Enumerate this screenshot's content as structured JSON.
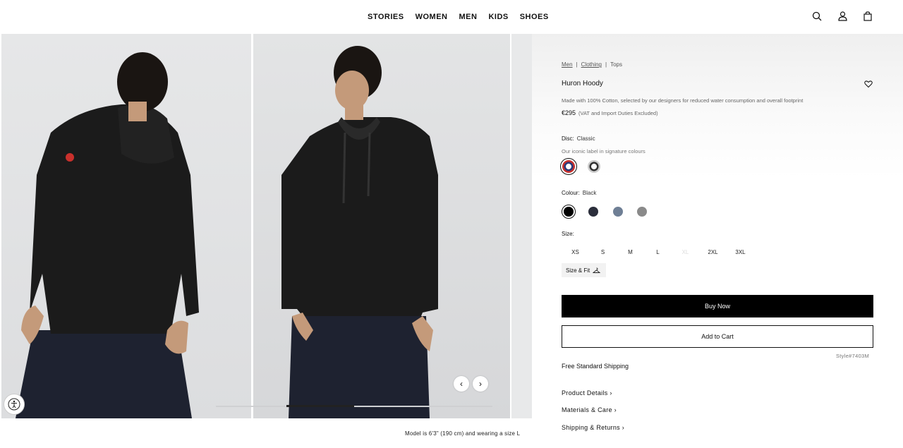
{
  "nav": {
    "links": [
      "STORIES",
      "WOMEN",
      "MEN",
      "KIDS",
      "SHOES"
    ],
    "icons": [
      "search-icon",
      "account-icon",
      "bag-icon"
    ]
  },
  "gallery": {
    "caption": "Model is 6'3\" (190 cm) and wearing a size L",
    "progress": 0.25
  },
  "product": {
    "breadcrumbs": [
      "Men",
      "Clothing",
      "Tops"
    ],
    "name": "Huron Hoody",
    "description": "Made with 100% Cotton, selected by our designers for reduced water consumption and overall footprint",
    "price": "€295",
    "tax_note": "(VAT and Import Duties Excluded)",
    "disc_label": "Disc:",
    "disc_value": "Classic",
    "disc_sub": "Our iconic label in signature colours",
    "colour_label": "Colour:",
    "colour_value": "Black",
    "colours": [
      "#000000",
      "#2b2e3b",
      "#6f7f95",
      "#8a8a8a"
    ],
    "size_label": "Size:",
    "sizes": [
      "XS",
      "S",
      "M",
      "L",
      "XL",
      "2XL",
      "3XL"
    ],
    "size_fit": "Size & Fit",
    "buy_now": "Buy Now",
    "add_to_cart": "Add to Cart",
    "style_no": "Style#7403M",
    "shipping": "Free Standard Shipping",
    "accordions": [
      "Product Details",
      "Materials & Care",
      "Shipping & Returns"
    ]
  }
}
